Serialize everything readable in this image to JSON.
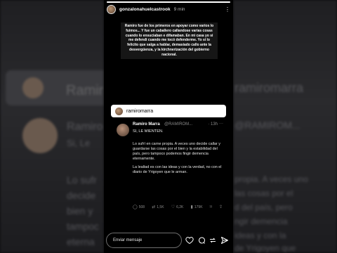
{
  "story": {
    "username": "gonzalonahuelcastrook",
    "time": "9 min",
    "progress": 1.0,
    "overlay_text": "Ramiro fue de los primeros en apoyar como varios lo fuimos... Y fue un caballero callandose varias cosas cuando lo ensuciaban e difamaban. En mi casa yo si me defendi cuando me tocó defenderme. Yo si lo felicito que salga a hablar, demasiado callo ante la desvergüenza, y la kirchnerización del gobierno nacional.",
    "mention": "ramiromarra"
  },
  "tweet": {
    "name": "Ramiro Marra",
    "handle": "@RAMIROM...",
    "time": "· 13h",
    "more": "···",
    "shout": "SI, LE MIENTEN.",
    "paragraphs": [
      "Lo sufrí en carne propia. A veces uno decide callar y guardarse las cosas por el bien y la estabilidad del país, pero tampoco podemos fingir demencia eternamente.",
      "La lealtad es con las ideas y con la verdad, no con el diario de Yrigoyen que le arman."
    ],
    "stats": {
      "replies": "508",
      "reposts": "1,5K",
      "likes": "6,2K",
      "views": "179K"
    }
  },
  "composer": {
    "placeholder": "Enviar mensaje"
  },
  "background": {
    "left_text": "Ramiro Marra",
    "left_small": "Si, Le",
    "left_lines": [
      "Lo sufr",
      "decide",
      "bien y",
      "tampoc",
      "eterna"
    ],
    "right_lines": [
      "ramiromarra",
      "@RAMIROM...",
      "propia. A veces uno",
      "las cosas por el",
      "d del país, pero",
      "ngir demencia",
      "ideas y con la",
      "de Yrigoyen que"
    ]
  }
}
